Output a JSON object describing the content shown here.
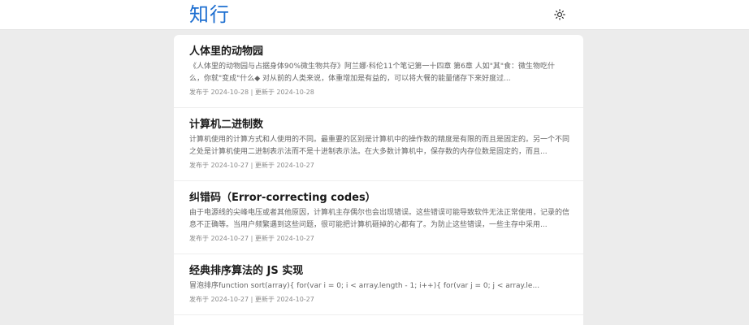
{
  "header": {
    "logo": "知行",
    "theme_icon": "sun-icon"
  },
  "articles": [
    {
      "title": "人体里的动物园",
      "excerpt": "《人体里的动物园与占据身体90%微生物共存》阿兰娜·科伦11个笔记第一十四章 第6章 人如\"其\"食：微生物吃什么，你就\"变成\"什么◆ 对从前的人类来说，体重增加是有益的，可以将大餐的能量储存下来好度过...",
      "meta": "发布于 2024-10-28 | 更新于 2024-10-28"
    },
    {
      "title": "计算机二进制数",
      "excerpt": "计算机使用的计算方式和人使用的不同。最重要的区别是计算机中的操作数的精度是有限的而且是固定的。另一个不同之处是计算机使用二进制表示法而不是十进制表示法。在大多数计算机中，保存数的内存位数是固定的，而且...",
      "meta": "发布于 2024-10-27 | 更新于 2024-10-27"
    },
    {
      "title": "纠错码（Error-correcting codes）",
      "excerpt": "由于电源线的尖峰电压或者其他原因，计算机主存偶尔也会出现错误。这些错误可能导致软件无法正常使用，记录的信息不正确等。当用户频繁遇到这些问题，很可能把计算机砸掉的心都有了。为防止这些错误，一些主存中采用...",
      "meta": "发布于 2024-10-27 | 更新于 2024-10-27"
    },
    {
      "title": "经典排序算法的 JS 实现",
      "excerpt": "冒泡排序function sort(array){ for(var i = 0; i < array.length - 1; i++){ for(var j = 0; j < array.le...",
      "meta": "发布于 2024-10-27 | 更新于 2024-10-27"
    }
  ]
}
